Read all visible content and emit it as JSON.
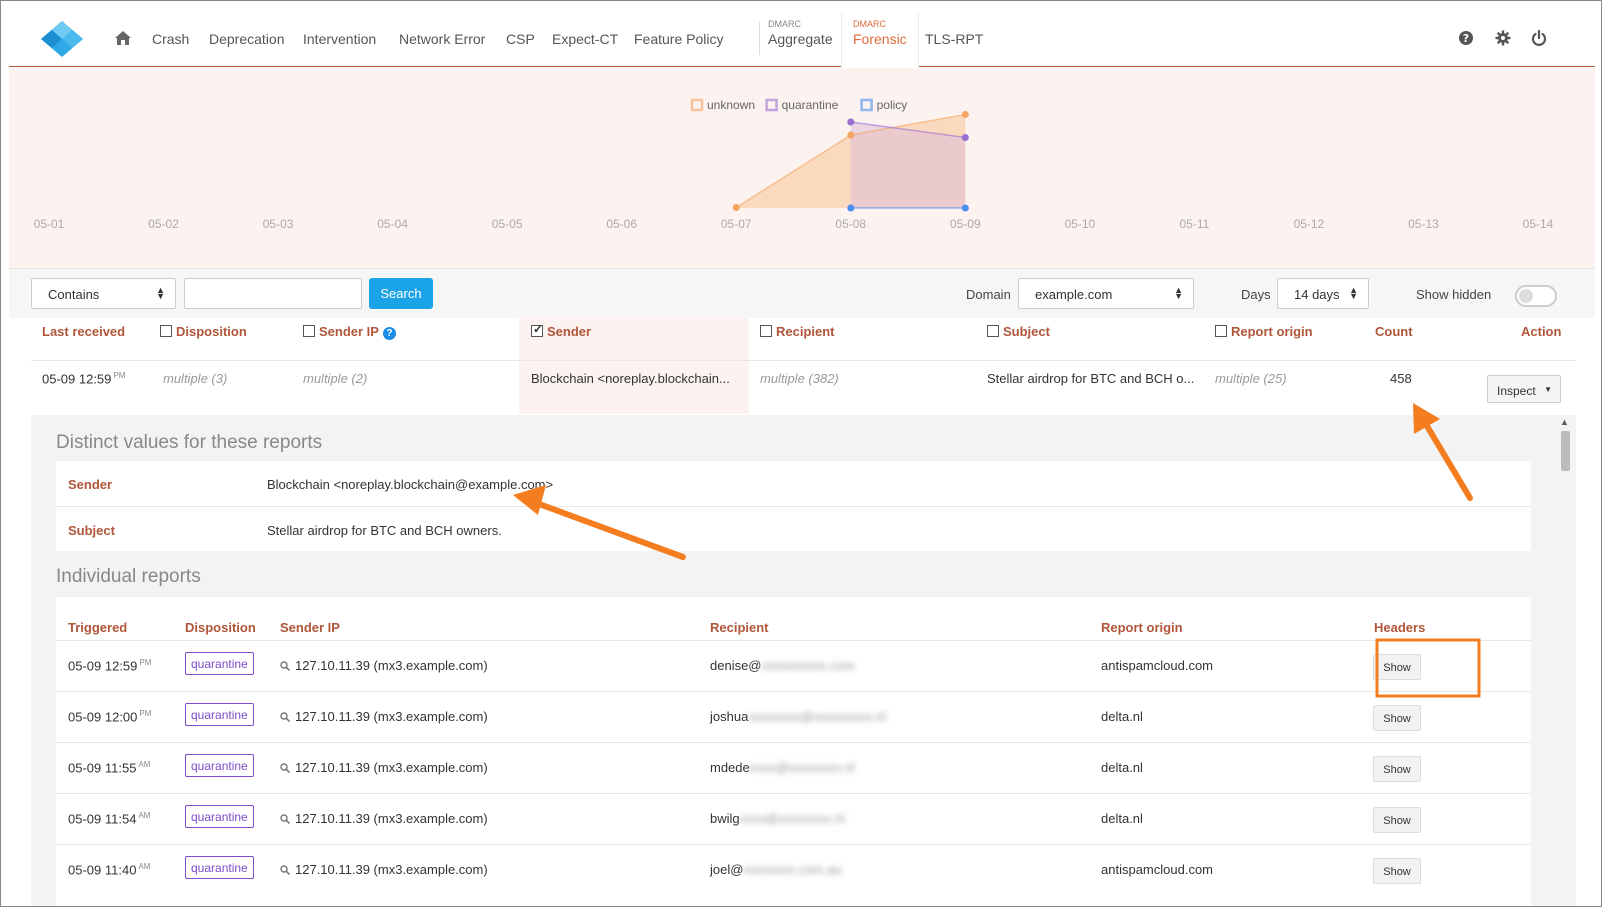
{
  "nav": {
    "items": [
      "Crash",
      "Deprecation",
      "Intervention",
      "Network Error",
      "CSP",
      "Expect-CT",
      "Feature Policy"
    ],
    "groups": [
      {
        "small": "DMARC",
        "label": "Aggregate",
        "active": false
      },
      {
        "small": "DMARC",
        "label": "Forensic",
        "active": true
      }
    ],
    "tls": "TLS-RPT"
  },
  "colors": {
    "accent": "#b0563a",
    "unknown": "#f5a561",
    "quarantine": "#9a6fd1",
    "policy": "#4a8ef0",
    "search": "#1ba3e8"
  },
  "chart_data": {
    "type": "area",
    "legend": [
      "unknown",
      "quarantine",
      "policy"
    ],
    "legend_position": "top-center",
    "x": [
      "05-01",
      "05-02",
      "05-03",
      "05-04",
      "05-05",
      "05-06",
      "05-07",
      "05-08",
      "05-09",
      "05-10",
      "05-11",
      "05-12",
      "05-13",
      "05-14"
    ],
    "series": [
      {
        "name": "unknown",
        "points": [
          [
            "05-07",
            1
          ],
          [
            "05-08",
            146
          ],
          [
            "05-09",
            187
          ]
        ]
      },
      {
        "name": "quarantine",
        "points": [
          [
            "05-08",
            172
          ],
          [
            "05-09",
            141
          ]
        ]
      },
      {
        "name": "policy",
        "points": [
          [
            "05-08",
            0
          ],
          [
            "05-09",
            0
          ]
        ]
      }
    ],
    "ylim": [
      0,
      200
    ]
  },
  "filter": {
    "mode": "Contains",
    "query": "",
    "search_label": "Search",
    "domain_label": "Domain",
    "domain": "example.com",
    "days_label": "Days",
    "days": "14 days",
    "show_hidden_label": "Show hidden"
  },
  "table": {
    "headers": {
      "last_received": "Last received",
      "disposition": "Disposition",
      "sender_ip": "Sender IP",
      "sender": "Sender",
      "recipient": "Recipient",
      "subject": "Subject",
      "report_origin": "Report origin",
      "count": "Count",
      "action": "Action"
    },
    "row": {
      "last_received": "05-09 12:59",
      "last_received_ampm": "PM",
      "disposition": "multiple (3)",
      "sender_ip": "multiple (2)",
      "sender": "Blockchain <noreplay.blockchain...",
      "recipient": "multiple (382)",
      "subject": "Stellar airdrop for BTC and BCH o...",
      "report_origin": "multiple (25)",
      "count": "458",
      "action": "Inspect"
    }
  },
  "distinct": {
    "title": "Distinct values for these reports",
    "rows": [
      {
        "label": "Sender",
        "value": "Blockchain <noreplay.blockchain@example.com>"
      },
      {
        "label": "Subject",
        "value": "Stellar airdrop for BTC and BCH owners."
      }
    ]
  },
  "individual": {
    "title": "Individual reports",
    "headers": {
      "triggered": "Triggered",
      "disposition": "Disposition",
      "sender_ip": "Sender IP",
      "recipient": "Recipient",
      "report_origin": "Report origin",
      "headers": "Headers"
    },
    "rows": [
      {
        "time": "05-09 12:59",
        "ampm": "PM",
        "disposition": "quarantine",
        "ip": "127.10.11.39 (mx3.example.com)",
        "recipient": "denise@",
        "recipient_hidden": "xxxxxxxxxx.com",
        "origin": "antispamcloud.com",
        "show": "Show"
      },
      {
        "time": "05-09 12:00",
        "ampm": "PM",
        "disposition": "quarantine",
        "ip": "127.10.11.39 (mx3.example.com)",
        "recipient": "joshua",
        "recipient_hidden": "xxxxxxxx@xxxxxxxxx.nl",
        "origin": "delta.nl",
        "show": "Show"
      },
      {
        "time": "05-09 11:55",
        "ampm": "AM",
        "disposition": "quarantine",
        "ip": "127.10.11.39 (mx3.example.com)",
        "recipient": "mdede",
        "recipient_hidden": "xxxx@xxxxxxxx.nl",
        "origin": "delta.nl",
        "show": "Show"
      },
      {
        "time": "05-09 11:54",
        "ampm": "AM",
        "disposition": "quarantine",
        "ip": "127.10.11.39 (mx3.example.com)",
        "recipient": "bwilg",
        "recipient_hidden": "xxxx@xxxxxxxx.nl",
        "origin": "delta.nl",
        "show": "Show"
      },
      {
        "time": "05-09 11:40",
        "ampm": "AM",
        "disposition": "quarantine",
        "ip": "127.10.11.39 (mx3.example.com)",
        "recipient": "joel@",
        "recipient_hidden": "xxxxxxxx.com.au",
        "origin": "antispamcloud.com",
        "show": "Show"
      }
    ]
  }
}
